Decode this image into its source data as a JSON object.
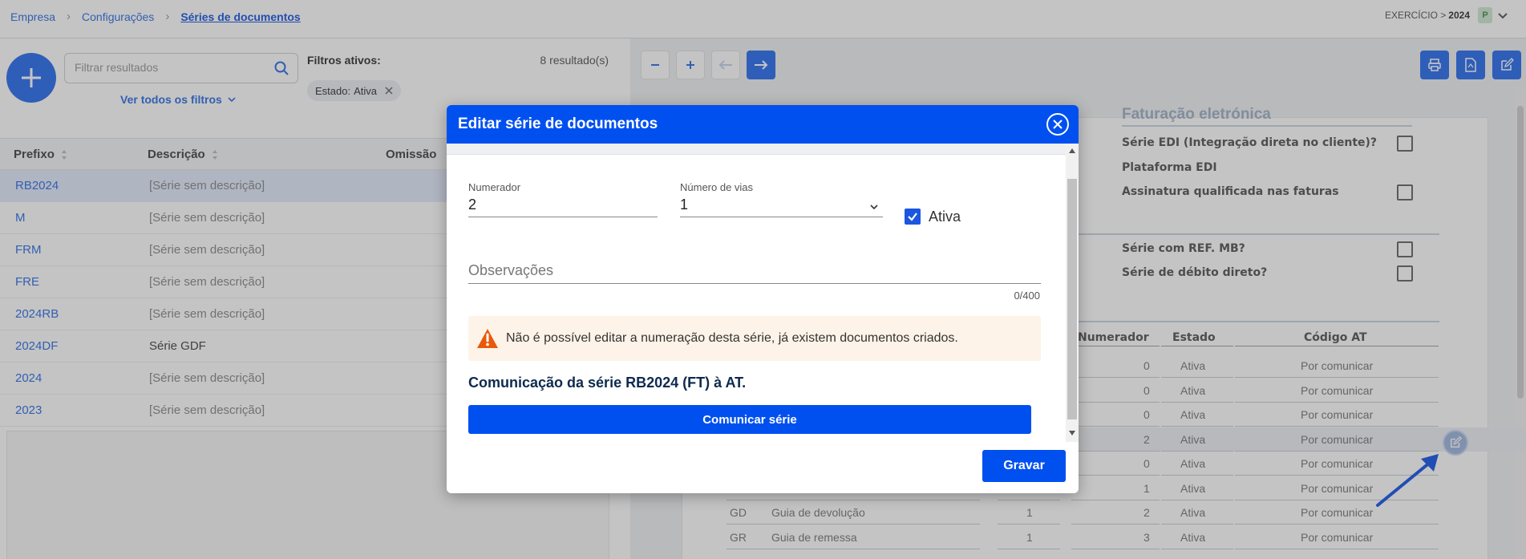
{
  "breadcrumb": {
    "items": [
      "Empresa",
      "Configurações",
      "Séries de documentos"
    ]
  },
  "exercicio": {
    "label": "EXERCÍCIO >",
    "year": "2024",
    "badge": "P"
  },
  "search": {
    "placeholder": "Filtrar resultados"
  },
  "filters": {
    "view_all": "Ver todos os filtros",
    "active_label": "Filtros ativos:",
    "chip_key": "Estado:",
    "chip_value": "Ativa",
    "result_count": "8 resultado(s)"
  },
  "table": {
    "headers": [
      "Prefixo",
      "Descrição",
      "Omissão"
    ],
    "rows": [
      {
        "prefix": "RB2024",
        "description": "[Série sem descrição]"
      },
      {
        "prefix": "M",
        "description": "[Série sem descrição]"
      },
      {
        "prefix": "FRM",
        "description": "[Série sem descrição]"
      },
      {
        "prefix": "FRE",
        "description": "[Série sem descrição]"
      },
      {
        "prefix": "2024RB",
        "description": "[Série sem descrição]"
      },
      {
        "prefix": "2024DF",
        "description": "Série GDF"
      },
      {
        "prefix": "2024",
        "description": "[Série sem descrição]"
      },
      {
        "prefix": "2023",
        "description": "[Série sem descrição]"
      }
    ]
  },
  "doc": {
    "title": "Faturação eletrónica",
    "labels": [
      "Série EDI (Integração direta no cliente)?",
      "Plataforma EDI",
      "Assinatura qualificada nas faturas",
      "Série com REF. MB?",
      "Série de débito direto?"
    ],
    "series_headers": [
      "Numerador",
      "Estado",
      "Código AT"
    ],
    "series_rows": [
      {
        "code": "",
        "name": "",
        "copies": "",
        "numerator": "0",
        "status": "Ativa",
        "at": "Por comunicar"
      },
      {
        "code": "",
        "name": "",
        "copies": "",
        "numerator": "0",
        "status": "Ativa",
        "at": "Por comunicar"
      },
      {
        "code": "",
        "name": "",
        "copies": "",
        "numerator": "0",
        "status": "Ativa",
        "at": "Por comunicar"
      },
      {
        "code": "",
        "name": "",
        "copies": "",
        "numerator": "2",
        "status": "Ativa",
        "at": "Por comunicar"
      },
      {
        "code": "",
        "name": "",
        "copies": "",
        "numerator": "0",
        "status": "Ativa",
        "at": "Por comunicar"
      },
      {
        "code": "",
        "name": "",
        "copies": "",
        "numerator": "1",
        "status": "Ativa",
        "at": "Por comunicar"
      },
      {
        "code": "GD",
        "name": "Guia de devolução",
        "copies": "1",
        "numerator": "2",
        "status": "Ativa",
        "at": "Por comunicar"
      },
      {
        "code": "GR",
        "name": "Guia de remessa",
        "copies": "1",
        "numerator": "3",
        "status": "Ativa",
        "at": "Por comunicar"
      }
    ]
  },
  "modal": {
    "title": "Editar série de documentos",
    "numerador_label": "Numerador",
    "numerador_value": "2",
    "vias_label": "Número de vias",
    "vias_value": "1",
    "ativa_label": "Ativa",
    "observacoes_label": "Observações",
    "counter": "0/400",
    "warning": "Não é possível editar a numeração desta série, já existem documentos criados.",
    "comunicacao_heading": "Comunicação da série RB2024 (FT) à AT.",
    "comunicar_button": "Comunicar série",
    "gravar_button": "Gravar"
  },
  "colors": {
    "primary": "#0050f0",
    "link": "#2f6fe6",
    "warning_bg": "#fdf3e8",
    "warning_icon": "#e8590c"
  }
}
